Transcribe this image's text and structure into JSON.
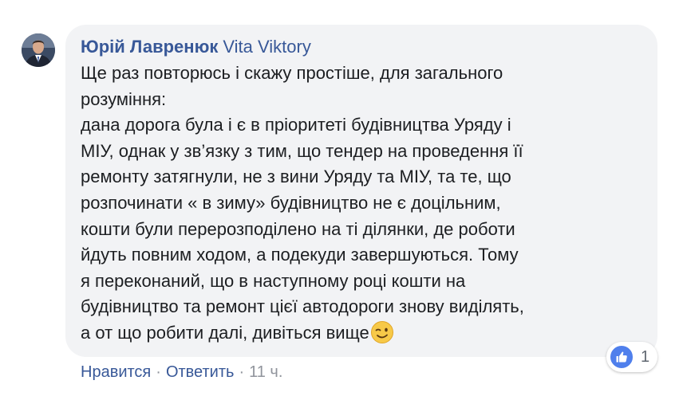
{
  "comment": {
    "author": "Юрій Лавренюк",
    "mention": "Vita Viktory",
    "lines": [
      "Ще раз повторюсь і скажу простіше, для загального",
      "розуміння:",
      "дана дорога була і є в пріоритеті будівництва Уряду і",
      "МІУ, однак у зв’язку з тим, що тендер на проведення її",
      "ремонту затягнули, не з вини Уряду та МІУ, та те, що",
      "розпочинати « в зиму» будівництво не є доцільним,",
      "кошти були перерозподілено на ті ділянки, де роботи",
      "йдуть повним ходом, а подекуди завершуються. Тому",
      "я переконаний, що в наступному році кошти на",
      "будівництво та ремонт цієї автодороги знову виділять,",
      "а от що робити далі, дивіться вище"
    ],
    "emoji": "winking-face-emoji"
  },
  "reactions": {
    "icon": "like-icon",
    "count": "1",
    "color": "#4f7fec"
  },
  "actions": {
    "like_label": "Нравится",
    "reply_label": "Ответить",
    "separator": "·",
    "timestamp": "11 ч."
  },
  "colors": {
    "link": "#385898",
    "bubble_bg": "#f2f3f5",
    "text": "#1c1e21",
    "meta": "#90949c"
  }
}
